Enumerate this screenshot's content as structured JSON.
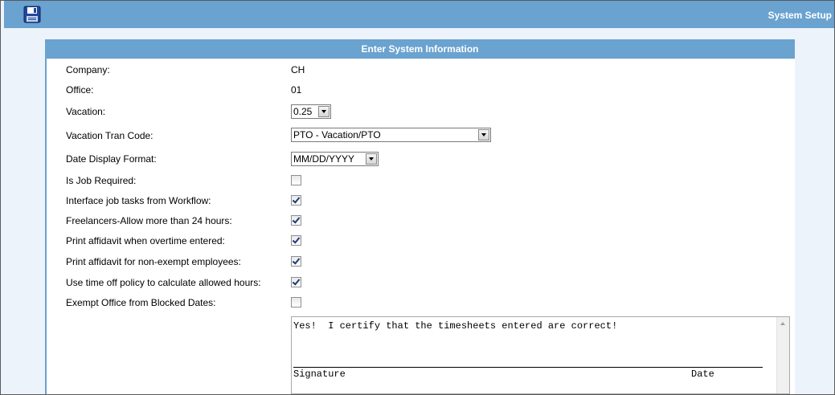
{
  "header": {
    "title": "System Setup"
  },
  "panel": {
    "title": "Enter System Information"
  },
  "fields": {
    "company": {
      "label": "Company:",
      "value": "CH"
    },
    "office": {
      "label": "Office:",
      "value": "01"
    },
    "vacation": {
      "label": "Vacation:",
      "value": "0.25"
    },
    "vacation_tran_code": {
      "label": "Vacation Tran Code:",
      "value": "PTO - Vacation/PTO"
    },
    "date_display_format": {
      "label": "Date Display Format:",
      "value": "MM/DD/YYYY"
    }
  },
  "checkboxes": [
    {
      "label": "Is Job Required:",
      "checked": false
    },
    {
      "label": "Interface job tasks from Workflow:",
      "checked": true
    },
    {
      "label": "Freelancers-Allow more than 24 hours:",
      "checked": true
    },
    {
      "label": "Print affidavit when overtime entered:",
      "checked": true
    },
    {
      "label": "Print affidavit for non-exempt employees:",
      "checked": true
    },
    {
      "label": "Use time off policy to calculate allowed hours:",
      "checked": true
    },
    {
      "label": "Exempt Office from Blocked Dates:",
      "checked": false
    }
  ],
  "affidavit": {
    "text": "Yes!  I certify that the timesheets entered are correct!",
    "signature_label": "Signature",
    "date_label": "Date"
  },
  "icons": {
    "save": "save-disk-icon"
  },
  "colors": {
    "header_bg": "#6aa2d0",
    "page_bg": "#edf3fa"
  }
}
